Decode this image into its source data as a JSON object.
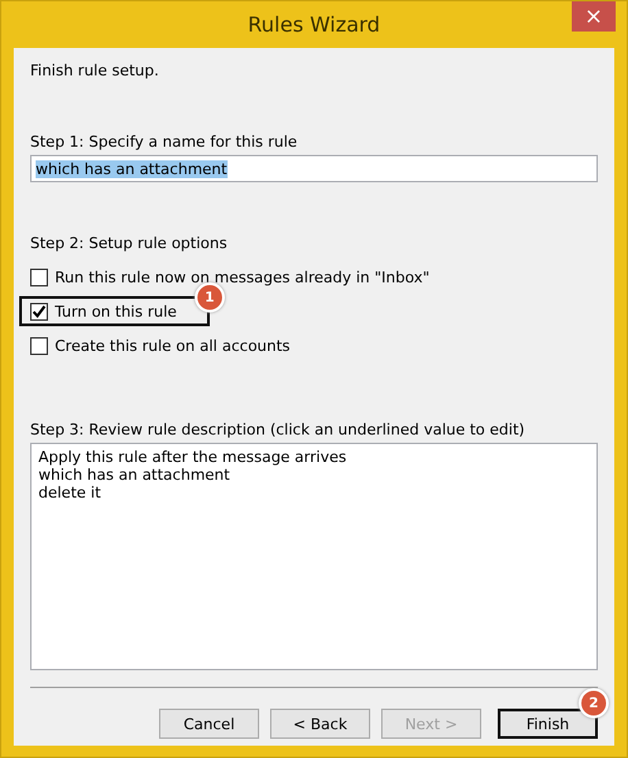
{
  "window": {
    "title": "Rules Wizard",
    "close_glyph": "×"
  },
  "heading": "Finish rule setup.",
  "step1": {
    "label": "Step 1: Specify a name for this rule",
    "value": "which has an attachment",
    "value_selected": true
  },
  "step2": {
    "label": "Step 2: Setup rule options",
    "options": [
      {
        "label": "Run this rule now on messages already in \"Inbox\"",
        "checked": false,
        "highlighted": false
      },
      {
        "label": "Turn on this rule",
        "checked": true,
        "highlighted": true,
        "callout": "1"
      },
      {
        "label": "Create this rule on all accounts",
        "checked": false,
        "highlighted": false
      }
    ]
  },
  "step3": {
    "label": "Step 3: Review rule description (click an underlined value to edit)",
    "lines": [
      "Apply this rule after the message arrives",
      "which has an attachment",
      "delete it"
    ]
  },
  "buttons": [
    {
      "label": "Cancel",
      "disabled": false,
      "highlighted": false
    },
    {
      "label": "< Back",
      "disabled": false,
      "highlighted": false
    },
    {
      "label": "Next >",
      "disabled": true,
      "highlighted": false
    },
    {
      "label": "Finish",
      "disabled": false,
      "highlighted": true,
      "callout": "2"
    }
  ]
}
